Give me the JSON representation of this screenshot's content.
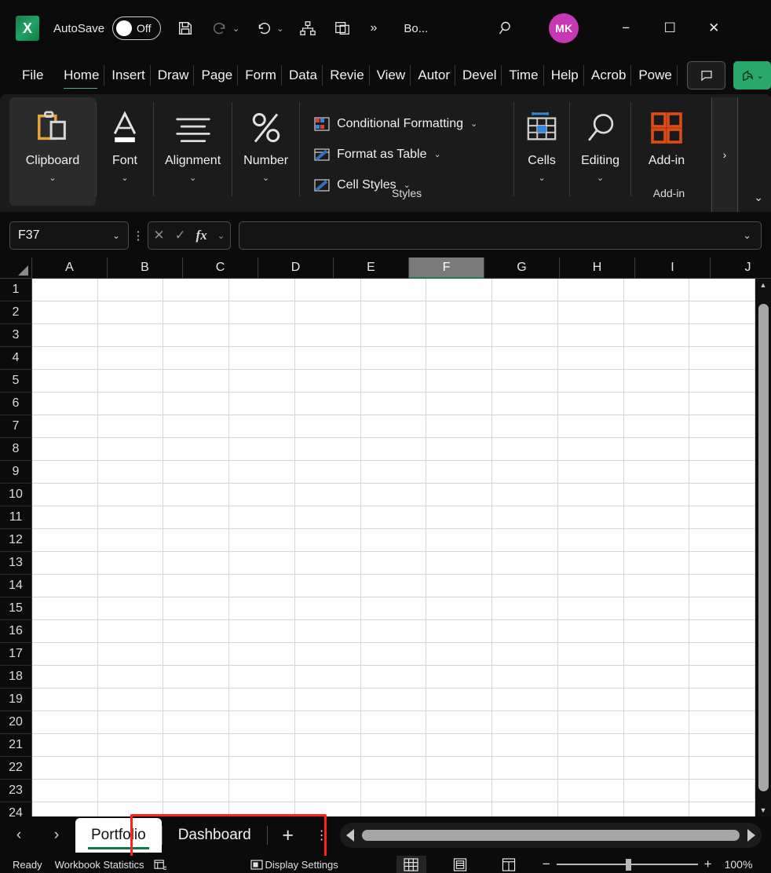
{
  "titlebar": {
    "app_icon": "excel-logo",
    "app_letter": "X",
    "autosave_label": "AutoSave",
    "autosave_state": "Off",
    "quick_access": [
      {
        "name": "save-icon",
        "label": "Save"
      },
      {
        "name": "redo-icon",
        "label": "Redo"
      },
      {
        "name": "undo-icon",
        "label": "Undo"
      },
      {
        "name": "sort-hierarchy-icon",
        "label": "Sort"
      },
      {
        "name": "arrange-windows-icon",
        "label": "Arrange Windows"
      }
    ],
    "more_commands": "»",
    "document_title": "Bo...",
    "search_icon": "search-icon",
    "account_initials": "MK",
    "account_color": "#c838b4",
    "window_buttons": {
      "minimize": "−",
      "maximize": "☐",
      "close": "✕"
    }
  },
  "ribbon_tabs": [
    {
      "label": "File",
      "active": false
    },
    {
      "label": "Home",
      "active": true
    },
    {
      "label": "Insert",
      "active": false
    },
    {
      "label": "Draw",
      "active": false
    },
    {
      "label": "Page",
      "active": false
    },
    {
      "label": "Form",
      "active": false
    },
    {
      "label": "Data",
      "active": false
    },
    {
      "label": "Revie",
      "active": false
    },
    {
      "label": "View",
      "active": false
    },
    {
      "label": "Autor",
      "active": false
    },
    {
      "label": "Devel",
      "active": false
    },
    {
      "label": "Time",
      "active": false
    },
    {
      "label": "Help",
      "active": false
    },
    {
      "label": "Acrob",
      "active": false
    },
    {
      "label": "Powe",
      "active": false
    }
  ],
  "ribbon_right": {
    "comment_icon": "comment-icon",
    "share_icon": "share-icon",
    "share_caret": "⌄"
  },
  "ribbon": {
    "groups": [
      {
        "label": "Clipboard",
        "icon": "clipboard-icon",
        "caret": "⌄",
        "boxed": true
      },
      {
        "label": "Font",
        "icon": "font-icon",
        "caret": "⌄",
        "boxed": false
      },
      {
        "label": "Alignment",
        "icon": "alignment-icon",
        "caret": "⌄",
        "boxed": false
      },
      {
        "label": "Number",
        "icon": "percent-icon",
        "caret": "⌄",
        "boxed": false
      }
    ],
    "styles": {
      "group_label": "Styles",
      "items": [
        {
          "label": "Conditional Formatting",
          "icon": "conditional-formatting-icon",
          "caret": "⌄"
        },
        {
          "label": "Format as Table",
          "icon": "format-as-table-icon",
          "caret": "⌄"
        },
        {
          "label": "Cell Styles",
          "icon": "cell-styles-icon",
          "caret": "⌄"
        }
      ]
    },
    "groups_right": [
      {
        "label": "Cells",
        "icon": "cells-icon",
        "caret": "⌄"
      },
      {
        "label": "Editing",
        "icon": "editing-magnifier-icon",
        "caret": "⌄"
      }
    ],
    "addins": {
      "label": "Add-in",
      "footer": "Add-in",
      "icon": "addins-icon"
    },
    "overflow_chevron": "›",
    "collapse_chevron": "⌄"
  },
  "formula_bar": {
    "name_box_value": "F37",
    "name_box_caret": "⌄",
    "kebab": "⋮",
    "cancel_icon": "cancel-x-icon",
    "enter_icon": "enter-check-icon",
    "function_icon": "fx",
    "function_caret": "⌄",
    "input_value": "",
    "expand_caret": "⌄"
  },
  "grid": {
    "columns": [
      "A",
      "B",
      "C",
      "D",
      "E",
      "F",
      "G",
      "H",
      "I",
      "J"
    ],
    "selected_column": "F",
    "rows": [
      1,
      2,
      3,
      4,
      5,
      6,
      7,
      8,
      9,
      10,
      11,
      12,
      13,
      14,
      15,
      16,
      17,
      18,
      19,
      20,
      21,
      22,
      23,
      24
    ],
    "cell_values": []
  },
  "sheet_bar": {
    "prev_icon": "‹",
    "next_icon": "›",
    "tabs": [
      {
        "label": "Portfolio",
        "active": true
      },
      {
        "label": "Dashboard",
        "active": false
      }
    ],
    "add_sheet": "+",
    "kebab": "⋮",
    "highlight_color": "#ff2020"
  },
  "status_bar": {
    "ready": "Ready",
    "workbook_statistics": "Workbook Statistics",
    "stats_icon": "statistics-icon",
    "display_settings": "Display Settings",
    "display_icon": "display-settings-icon",
    "views": [
      {
        "name": "normal-view",
        "active": true
      },
      {
        "name": "page-layout-view",
        "active": false
      },
      {
        "name": "page-break-preview",
        "active": false
      }
    ],
    "zoom_out": "−",
    "zoom_in": "+",
    "zoom_level": "100%"
  }
}
